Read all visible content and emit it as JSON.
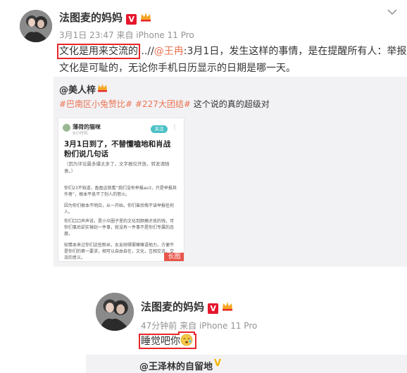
{
  "post1": {
    "user_name": "法图麦的妈妈",
    "meta": "3月1日 23:47 来自 iPhone 11 Pro",
    "text_boxed": "文化是用来交流的",
    "text_sep": "...//",
    "mention": "@王冉",
    "text_rest_line1": ":3月1日，发生这样的事情，是在提醒所有人：举报",
    "text_line2": "文化是可耻的，无论你手机日历显示的日期是哪一天。",
    "repost": {
      "user": "@美人梓",
      "hashtags": "#巴南区小兔赞比# #227大团结#",
      "text": " 这个说的真的超级对",
      "image": {
        "header_user": "薄荷的猫咪",
        "header_sub": "9小时前",
        "follow_label": "关注",
        "title": "3月1日到了，不替懂嗑地和肖战粉们说几句话",
        "note": "（因为评论最多爆太多了，文字报仅开放，转发请随意。）",
        "para1": "你们23不知道，盈盈这就看“我们没有举报ao3，只是举报其作者”，根本平息不了别人的怒火。",
        "para2": "因为你们根本不明白，从一开始，你们曾后悔不该举报任何人。",
        "para3": "你们口口声声说，是小众圈子里的文化到颜摘才底的钱，可你们事后却实禅封一件事，就没有一件事不是你们专属的态度。",
        "para4": "知情本来过你们这些粉丝，女友刚得罪嘛嘛语他力，方便不是你们的第一要求，相可以自由自在，文化，互相交流，交流的意义。",
        "long_image_label": "长图"
      }
    }
  },
  "post2": {
    "user_name": "法图麦的妈妈",
    "meta": "47分钟前 来自 iPhone 11 Pro",
    "text_boxed": "睡觉吧你",
    "repost_user": "@王泽林的自留地"
  },
  "colors": {
    "accent": "#eb7350",
    "highlight_box": "#e8262a",
    "vip_red": "#e6162d",
    "follow_teal": "#4cc1c7"
  },
  "icons": {
    "chevron": "chevron-down-icon",
    "verified": "verified-v-icon",
    "crown": "crown-icon",
    "emoji": "sleepy-face-emoji-icon",
    "gold_v": "gold-v-icon"
  }
}
